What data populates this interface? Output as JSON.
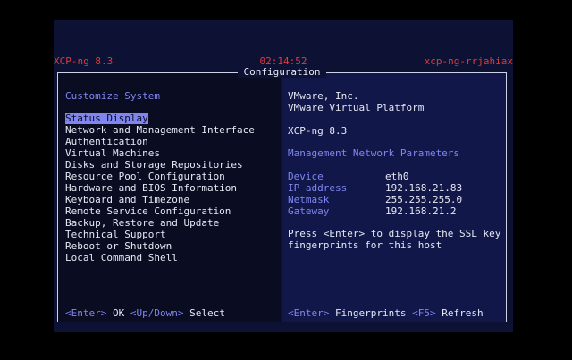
{
  "header": {
    "version": "XCP-ng 8.3",
    "clock": "02:14:52",
    "hostname": "xcp-ng-rrjahiax"
  },
  "dialog": {
    "title": "Configuration"
  },
  "menu": {
    "heading": "Customize System",
    "items": [
      "Status Display",
      "Network and Management Interface",
      "Authentication",
      "Virtual Machines",
      "Disks and Storage Repositories",
      "Resource Pool Configuration",
      "Hardware and BIOS Information",
      "Keyboard and Timezone",
      "Remote Service Configuration",
      "Backup, Restore and Update",
      "Technical Support",
      "Reboot or Shutdown",
      "Local Command Shell"
    ],
    "selected_index": 0
  },
  "left_footer": {
    "key1": "<Enter>",
    "action1": "OK",
    "key2": "<Up/Down>",
    "action2": "Select"
  },
  "details": {
    "vendor": "VMware, Inc.",
    "platform": "VMware Virtual Platform",
    "product": "XCP-ng 8.3",
    "section_title": "Management Network Parameters",
    "params": [
      {
        "label": "Device",
        "value": "eth0"
      },
      {
        "label": "IP address",
        "value": "192.168.21.83"
      },
      {
        "label": "Netmask",
        "value": "255.255.255.0"
      },
      {
        "label": "Gateway",
        "value": "192.168.21.2"
      }
    ],
    "hint_line1": "Press <Enter> to display the SSL key",
    "hint_line2": "fingerprints for this host"
  },
  "right_footer": {
    "key1": "<Enter>",
    "action1": "Fingerprints",
    "key2": "<F5>",
    "action2": "Refresh"
  },
  "colors": {
    "accent": "#7f86f0",
    "header_red": "#e03a3a",
    "left_bg": "#0a0c22",
    "right_bg": "#12174a"
  }
}
